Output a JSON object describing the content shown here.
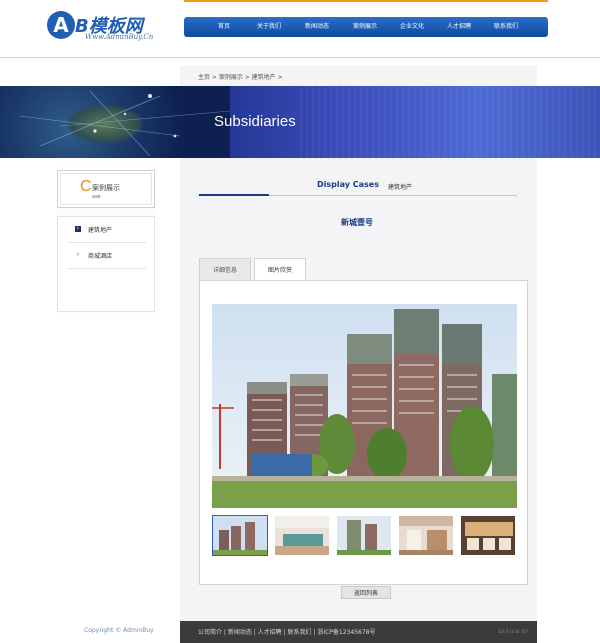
{
  "logo": {
    "letter": "A",
    "name": "B模板网",
    "url": "Www.AdminBuy.Cn"
  },
  "nav": [
    "首页",
    "关于我们",
    "新闻动态",
    "案例展示",
    "企业文化",
    "人才招聘",
    "联系我们"
  ],
  "breadcrumb": "主页 > 案例展示 > 建筑地产 >",
  "banner": {
    "title": "Subsidiaries"
  },
  "category": {
    "letter": "C",
    "cn": "案例展示",
    "en": "ase"
  },
  "sidebar": {
    "items": [
      {
        "label": "建筑地产",
        "arrow": "›"
      },
      {
        "label": "商城酒店",
        "arrow": "›"
      }
    ]
  },
  "section": {
    "title_en": "Display Cases",
    "title_cn": "建筑地产"
  },
  "project": {
    "title": "新城壹号"
  },
  "tabs": [
    {
      "label": "详细信息"
    },
    {
      "label": "图片欣赏"
    }
  ],
  "back_button": "返回列表",
  "footer": {
    "links": "公司简介 | 新闻动态 | 人才招聘 | 联系我们 | 浙ICP备12345678号",
    "design": "DESIGN BY"
  },
  "copyright": "Copyright © AdminBuy",
  "colors": {
    "brand_blue": "#1f5fb4",
    "accent_orange": "#f39a1c",
    "nav_blue": "#1a4fa8",
    "footer_dark": "#3b3b3d"
  }
}
